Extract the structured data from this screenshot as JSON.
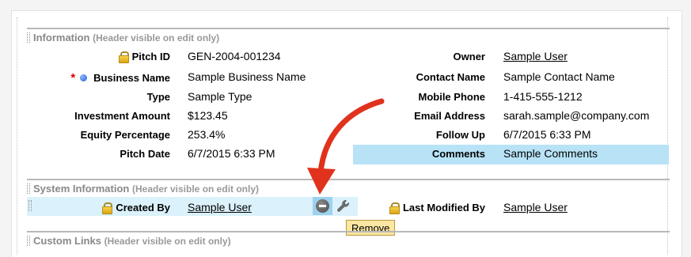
{
  "sections": {
    "information": {
      "title": "Information",
      "note": "(Header visible on edit only)"
    },
    "system_information": {
      "title": "System Information",
      "note": "(Header visible on edit only)"
    },
    "custom_links": {
      "title": "Custom Links",
      "note": "(Header visible on edit only)"
    }
  },
  "left_fields": [
    {
      "label": "Pitch ID",
      "value": "GEN-2004-001234"
    },
    {
      "label": "Business Name",
      "value": "Sample Business Name"
    },
    {
      "label": "Type",
      "value": "Sample Type"
    },
    {
      "label": "Investment Amount",
      "value": "$123.45"
    },
    {
      "label": "Equity Percentage",
      "value": "253.4%"
    },
    {
      "label": "Pitch Date",
      "value": "6/7/2015 6:33 PM"
    }
  ],
  "right_fields": [
    {
      "label": "Owner",
      "value": "Sample User"
    },
    {
      "label": "Contact Name",
      "value": "Sample Contact Name"
    },
    {
      "label": "Mobile Phone",
      "value": "1-415-555-1212"
    },
    {
      "label": "Email Address",
      "value": "sarah.sample@company.com"
    },
    {
      "label": "Follow Up",
      "value": "6/7/2015 6:33 PM"
    },
    {
      "label": "Comments",
      "value": "Sample Comments"
    }
  ],
  "system_fields": [
    {
      "label": "Created By",
      "value": "Sample User"
    },
    {
      "label": "Last Modified By",
      "value": "Sample User"
    }
  ],
  "required_marker": "*",
  "tooltip": "Remove",
  "icons": {
    "lock": "lock-icon",
    "remove": "remove-icon",
    "wrench": "wrench-icon"
  },
  "colors": {
    "highlight": "#b8e3f7",
    "highlight_light": "#dbf1fb",
    "arrow": "#e0321c",
    "required": "#d40000"
  }
}
